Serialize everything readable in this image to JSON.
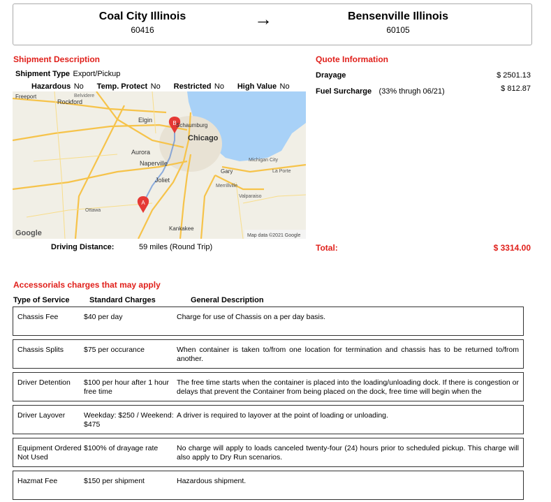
{
  "route": {
    "origin_city": "Coal City Illinois",
    "origin_zip": "60416",
    "arrow": "→",
    "destination_city": "Bensenville Illinois",
    "destination_zip": "60105"
  },
  "shipment": {
    "heading": "Shipment Description",
    "type_label": "Shipment Type",
    "type_value": "Export/Pickup",
    "hazardous_label": "Hazardous",
    "hazardous_value": "No",
    "temp_label": "Temp. Protect",
    "temp_value": "No",
    "restricted_label": "Restricted",
    "restricted_value": "No",
    "highvalue_label": "High Value",
    "highvalue_value": "No"
  },
  "map": {
    "places": {
      "freeport": "Freeport",
      "belvidere": "Belvidere",
      "rockford": "Rockford",
      "elgin": "Elgin",
      "schaumburg": "Schaumburg",
      "chicago": "Chicago",
      "aurora": "Aurora",
      "naperville": "Naperville",
      "joliet": "Joliet",
      "gary": "Gary",
      "michigan_city": "Michigan City",
      "la_porte": "La Porte",
      "merrillville": "Merrillville",
      "valparaiso": "Valparaiso",
      "ottawa": "Ottawa",
      "kankakee": "Kankakee"
    },
    "marker_a": "A",
    "marker_b": "B",
    "logo": "Google",
    "attribution": "Map data ©2021 Google",
    "colors": {
      "land": "#f1efe6",
      "water": "#a8d1f7",
      "road": "#f6c34a",
      "marker": "#e53935"
    }
  },
  "distance": {
    "label": "Driving Distance:",
    "value": "59 miles (Round Trip)"
  },
  "quote": {
    "heading": "Quote Information",
    "drayage_label": "Drayage",
    "drayage_value": "$ 2501.13",
    "fuel_label": "Fuel Surcharge",
    "fuel_note": "(33% thrugh 06/21)",
    "fuel_value": "$ 812.87",
    "total_label": "Total:",
    "total_value": "$ 3314.00"
  },
  "accessorials": {
    "heading": "Accessorials charges that may apply",
    "headers": [
      "Type of Service",
      "Standard Charges",
      "General Description"
    ],
    "rows": [
      {
        "type": "Chassis Fee",
        "charge": "$40 per day",
        "desc": "Charge for use of Chassis on a per day basis."
      },
      {
        "type": "Chassis Splits",
        "charge": "$75 per occurance",
        "desc": "When container is taken to/from one location for termination and chassis has to be returned to/from another."
      },
      {
        "type": "Driver Detention",
        "charge": "$100 per hour after 1 hour free time",
        "desc": "The free time starts when the container is placed into the loading/unloading dock. If there is congestion or delays that prevent the Container from being placed on the dock, free time will begin when the"
      },
      {
        "type": "Driver Layover",
        "charge": "Weekday: $250 / Weekend: $475",
        "desc": "A driver is required to layover at the point of loading or unloading."
      },
      {
        "type": "Equipment Ordered Not Used",
        "charge": "$100% of drayage rate",
        "desc": "No charge will apply to loads canceled twenty-four (24) hours prior to scheduled pickup. This charge will also apply to Dry Run scenarios."
      },
      {
        "type": "Hazmat Fee",
        "charge": "$150 per shipment",
        "desc": "Hazardous shipment."
      }
    ]
  }
}
